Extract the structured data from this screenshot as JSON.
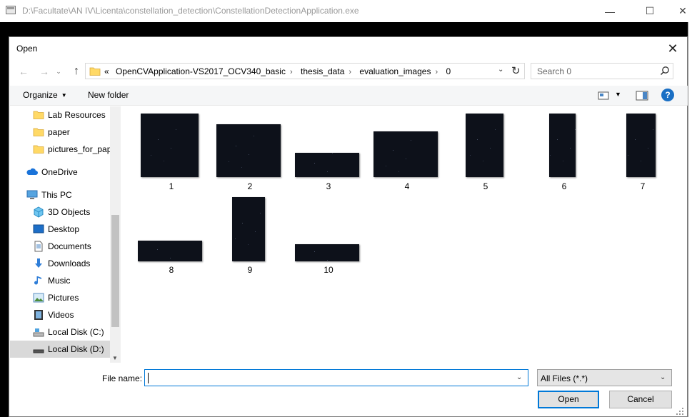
{
  "app_window": {
    "title": "D:\\Facultate\\AN IV\\Licenta\\constellation_detection\\ConstellationDetectionApplication.exe",
    "minimize_glyph": "—",
    "maximize_glyph": "☐",
    "close_glyph": "✕"
  },
  "dialog": {
    "title": "Open",
    "close_glyph": "✕"
  },
  "navigation": {
    "back_glyph": "←",
    "forward_glyph": "→",
    "recent_glyph": "⌄",
    "up_glyph": "↑",
    "breadcrumb": [
      "«",
      "OpenCVApplication-VS2017_OCV340_basic",
      "thesis_data",
      "evaluation_images",
      "0"
    ],
    "breadcrumb_separators": [
      "›",
      "›",
      "›",
      "›"
    ],
    "address_dropdown_glyph": "⌄",
    "refresh_glyph": "↻",
    "search_placeholder": "Search 0"
  },
  "toolbar": {
    "organize_label": "Organize",
    "organize_caret": "▼",
    "new_folder_label": "New folder",
    "view_caret": "▼",
    "help_glyph": "?"
  },
  "sidebar": {
    "items": [
      {
        "label": "Lab Resources",
        "icon": "folder-icon"
      },
      {
        "label": "paper",
        "icon": "folder-icon"
      },
      {
        "label": "pictures_for_pap",
        "icon": "folder-icon"
      },
      {
        "label": "OneDrive",
        "icon": "onedrive-icon"
      },
      {
        "label": "This PC",
        "icon": "this-pc-icon"
      },
      {
        "label": "3D Objects",
        "icon": "3d-objects-icon"
      },
      {
        "label": "Desktop",
        "icon": "desktop-icon"
      },
      {
        "label": "Documents",
        "icon": "documents-icon"
      },
      {
        "label": "Downloads",
        "icon": "downloads-icon"
      },
      {
        "label": "Music",
        "icon": "music-icon"
      },
      {
        "label": "Pictures",
        "icon": "pictures-icon"
      },
      {
        "label": "Videos",
        "icon": "videos-icon"
      },
      {
        "label": "Local Disk (C:)",
        "icon": "local-disk-c-icon"
      },
      {
        "label": "Local Disk (D:)",
        "icon": "local-disk-d-icon",
        "selected": true
      }
    ],
    "scroll_down_glyph": "▼"
  },
  "files": [
    {
      "label": "1"
    },
    {
      "label": "2"
    },
    {
      "label": "3"
    },
    {
      "label": "4"
    },
    {
      "label": "5"
    },
    {
      "label": "6"
    },
    {
      "label": "7"
    },
    {
      "label": "8"
    },
    {
      "label": "9"
    },
    {
      "label": "10"
    }
  ],
  "bottom": {
    "file_name_label": "File name:",
    "file_name_value": "",
    "file_name_dropdown_glyph": "⌄",
    "file_type_value": "All Files (*.*)",
    "file_type_dropdown_glyph": "⌄",
    "open_label": "Open",
    "cancel_label": "Cancel"
  },
  "colors": {
    "accent": "#0078d7",
    "thumbnail_bg": "#0d111a",
    "selection_bg": "#d9d9d9",
    "help_blue": "#1a6fc4"
  }
}
